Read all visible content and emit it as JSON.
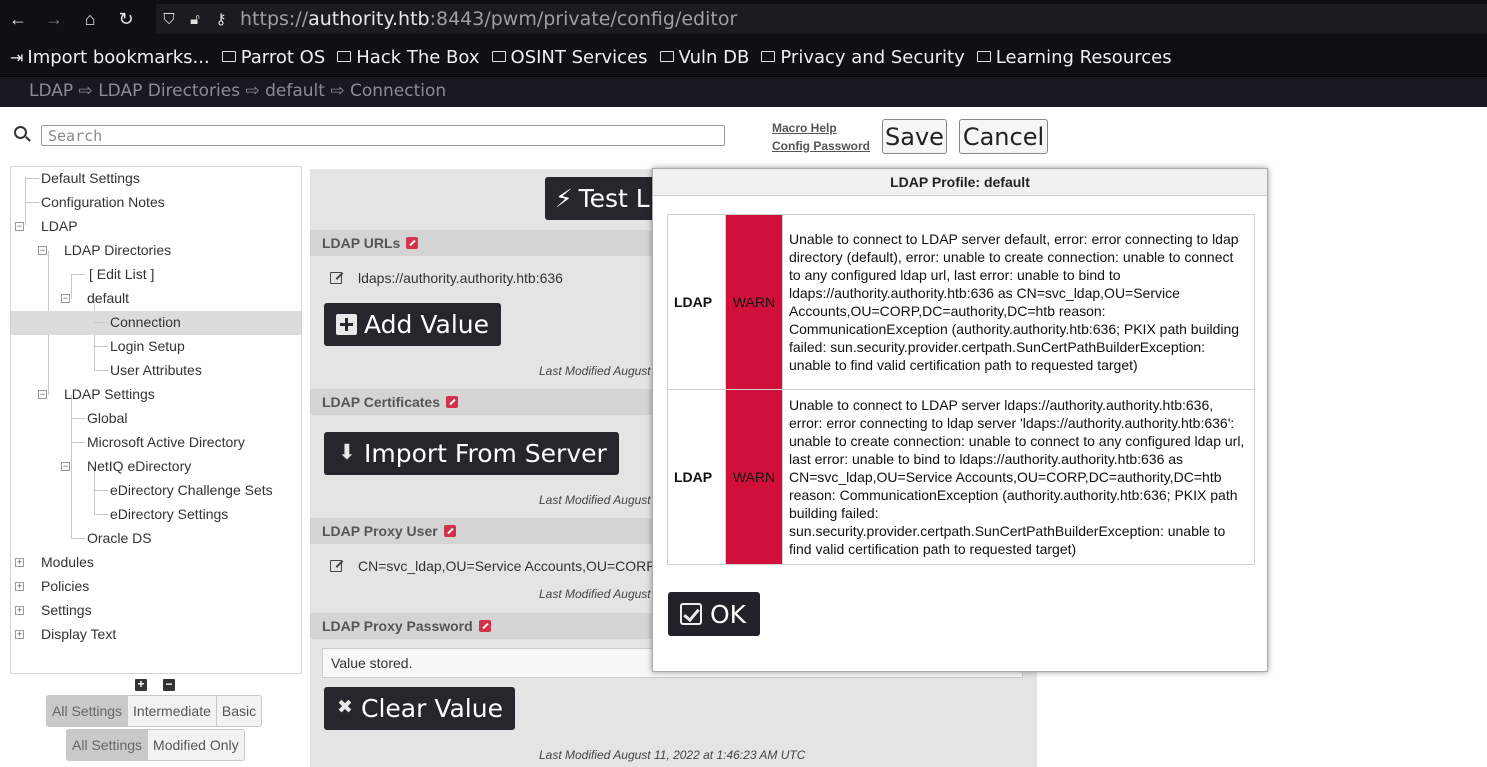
{
  "browser": {
    "url_scheme": "https://",
    "url_host": "authority.htb",
    "url_rest": ":8443/pwm/private/config/editor"
  },
  "bookmarks": [
    {
      "label": "Import bookmarks...",
      "icon": "import-icon"
    },
    {
      "label": "Parrot OS",
      "icon": "folder-icon"
    },
    {
      "label": "Hack The Box",
      "icon": "folder-icon"
    },
    {
      "label": "OSINT Services",
      "icon": "folder-icon"
    },
    {
      "label": "Vuln DB",
      "icon": "folder-icon"
    },
    {
      "label": "Privacy and Security",
      "icon": "folder-icon"
    },
    {
      "label": "Learning Resources",
      "icon": "folder-icon"
    }
  ],
  "header": {
    "breadcrumb": "LDAP ⇨ LDAP Directories ⇨ default ⇨ Connection"
  },
  "toolbar": {
    "search_placeholder": "Search",
    "macro_help": "Macro Help",
    "config_password": "Config Password",
    "save_label": "Save",
    "cancel_label": "Cancel"
  },
  "tree": {
    "items": [
      {
        "label": "Default Settings"
      },
      {
        "label": "Configuration Notes"
      },
      {
        "label": "LDAP"
      },
      {
        "label": "LDAP Directories"
      },
      {
        "label": "[ Edit List ]"
      },
      {
        "label": "default"
      },
      {
        "label": "Connection"
      },
      {
        "label": "Login Setup"
      },
      {
        "label": "User Attributes"
      },
      {
        "label": "LDAP Settings"
      },
      {
        "label": "Global"
      },
      {
        "label": "Microsoft Active Directory"
      },
      {
        "label": "NetIQ eDirectory"
      },
      {
        "label": "eDirectory Challenge Sets"
      },
      {
        "label": "eDirectory Settings"
      },
      {
        "label": "Oracle DS"
      },
      {
        "label": "Modules"
      },
      {
        "label": "Policies"
      },
      {
        "label": "Settings"
      },
      {
        "label": "Display Text"
      }
    ],
    "expand_all": "+",
    "collapse_all": "−"
  },
  "filters": {
    "level": [
      "All Settings",
      "Intermediate",
      "Basic"
    ],
    "modified": [
      "All Settings",
      "Modified Only"
    ]
  },
  "settings": {
    "test_button": "Test LDAP Profile",
    "ldap_urls": {
      "title": "LDAP URLs",
      "value": "ldaps://authority.authority.htb:636",
      "add_button": "Add Value",
      "last_modified": "Last Modified August"
    },
    "ldap_certificates": {
      "title": "LDAP Certificates",
      "import_button": "Import From Server",
      "last_modified": "Last Modified August"
    },
    "ldap_proxy_user": {
      "title": "LDAP Proxy User",
      "value": "CN=svc_ldap,OU=Service Accounts,OU=CORP,DC=authority,DC=htb",
      "last_modified": "Last Modified August"
    },
    "ldap_proxy_password": {
      "title": "LDAP Proxy Password",
      "value": "Value stored.",
      "clear_button": "Clear Value",
      "last_modified": "Last Modified August 11, 2022 at 1:46:23 AM UTC"
    }
  },
  "dialog": {
    "title": "LDAP Profile: default",
    "status_color": "#d0103a",
    "rows": [
      {
        "name": "LDAP",
        "status": "WARN",
        "message": "Unable to connect to LDAP server default, error: error connecting to ldap directory (default), error: unable to create connection: unable to connect to any configured ldap url, last error: unable to bind to ldaps://authority.authority.htb:636 as CN=svc_ldap,OU=Service Accounts,OU=CORP,DC=authority,DC=htb reason: CommunicationException (authority.authority.htb:636; PKIX path building failed: sun.security.provider.certpath.SunCertPathBuilderException: unable to find valid certification path to requested target)"
      },
      {
        "name": "LDAP",
        "status": "WARN",
        "message": "Unable to connect to LDAP server ldaps://authority.authority.htb:636, error: error connecting to ldap server 'ldaps://authority.authority.htb:636': unable to create connection: unable to connect to any configured ldap url, last error: unable to bind to ldaps://authority.authority.htb:636 as CN=svc_ldap,OU=Service Accounts,OU=CORP,DC=authority,DC=htb reason: CommunicationException (authority.authority.htb:636; PKIX path building failed: sun.security.provider.certpath.SunCertPathBuilderException: unable to find valid certification path to requested target)"
      }
    ],
    "ok_label": "OK"
  }
}
